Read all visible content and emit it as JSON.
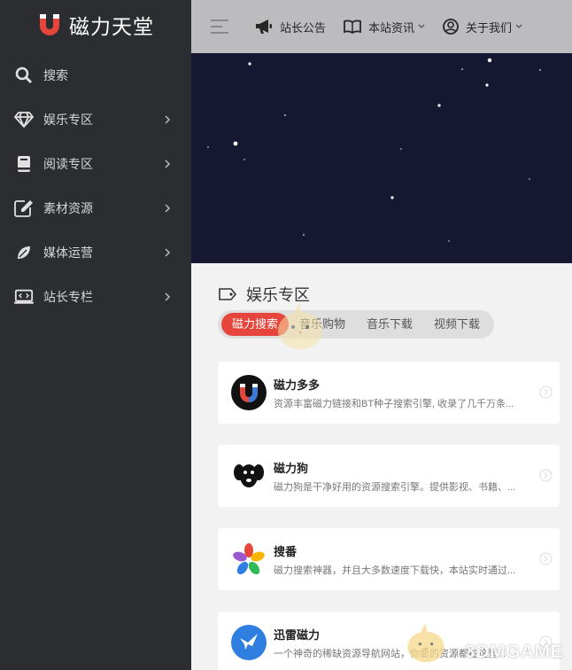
{
  "brand": {
    "title": "磁力天堂",
    "accent": "#e5453a"
  },
  "sidebar": {
    "items": [
      {
        "label": "搜索",
        "icon": "search-icon",
        "has_submenu": false
      },
      {
        "label": "娱乐专区",
        "icon": "diamond-icon",
        "has_submenu": true
      },
      {
        "label": "阅读专区",
        "icon": "book-icon",
        "has_submenu": true
      },
      {
        "label": "素材资源",
        "icon": "edit-icon",
        "has_submenu": true
      },
      {
        "label": "媒体运营",
        "icon": "leaf-icon",
        "has_submenu": true
      },
      {
        "label": "站长专栏",
        "icon": "monitor-icon",
        "has_submenu": true
      }
    ]
  },
  "topbar": {
    "announcement": "站长公告",
    "news": "本站资讯",
    "about": "关于我们"
  },
  "section": {
    "title": "娱乐专区",
    "tabs": [
      {
        "label": "磁力搜索",
        "active": true
      },
      {
        "label": "音乐购物",
        "active": false
      },
      {
        "label": "音乐下载",
        "active": false
      },
      {
        "label": "视频下载",
        "active": false
      }
    ]
  },
  "cards": [
    {
      "title": "磁力多多",
      "desc": "资源丰富磁力链接和BT种子搜索引擎, 收录了几千万条...",
      "icon": "magnet-logo-icon"
    },
    {
      "title": "磁力狗",
      "desc": "磁力狗是干净好用的资源搜索引擎。提供影视、书籍、...",
      "icon": "dog-logo-icon"
    },
    {
      "title": "搜番",
      "desc": "磁力搜索神器，并且大多数速度下载快，本站实时通过...",
      "icon": "flower-logo-icon"
    },
    {
      "title": "迅雷磁力",
      "desc": "一个神奇的稀缺资源导航网站，你要的资源都在这里...",
      "icon": "bird-logo-icon"
    }
  ],
  "watermark": "3DMGAME"
}
